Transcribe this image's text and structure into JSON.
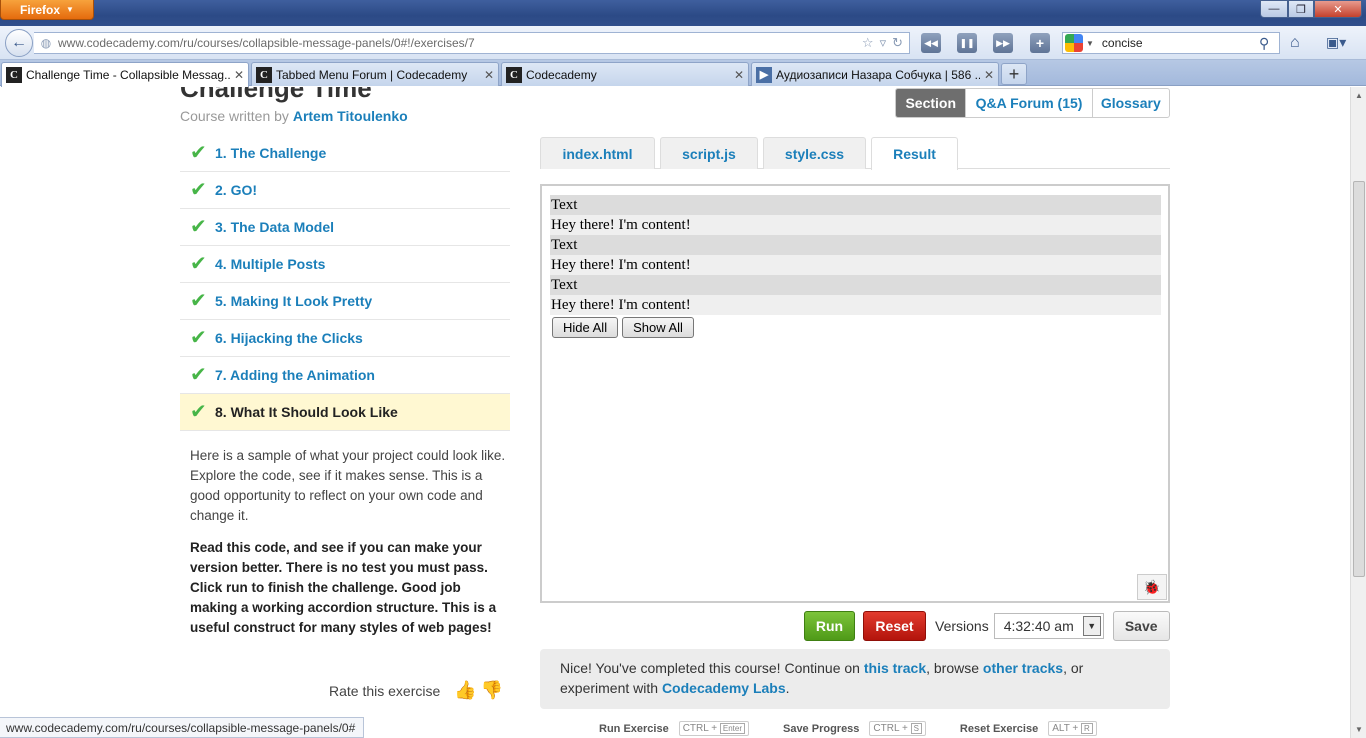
{
  "browser": {
    "menu_button": "Firefox",
    "url": "www.codecademy.com/ru/courses/collapsible-message-panels/0#!/exercises/7",
    "search_text": "concise",
    "window_controls": {
      "minimize": "—",
      "maximize": "❐",
      "close": "✕"
    },
    "tabs": [
      {
        "label": "Challenge Time - Collapsible Messag...",
        "close": "✕",
        "favicon": "C"
      },
      {
        "label": "Tabbed Menu Forum | Codecademy",
        "close": "✕",
        "favicon": "C"
      },
      {
        "label": "Codecademy",
        "close": "✕",
        "favicon": "C"
      },
      {
        "label": "Аудиозаписи Назара Собчука | 586 ...",
        "close": "✕",
        "favicon": "▶"
      }
    ],
    "new_tab": "+",
    "status_url": "www.codecademy.com/ru/courses/collapsible-message-panels/0#"
  },
  "course": {
    "title": "Challenge Time",
    "byline_prefix": "Course written by ",
    "author": "Artem Titoulenko"
  },
  "section_tabs": {
    "section": "Section",
    "forum": "Q&A Forum (15)",
    "glossary": "Glossary"
  },
  "lessons": [
    {
      "label": "1. The Challenge"
    },
    {
      "label": "2. GO!"
    },
    {
      "label": "3. The Data Model"
    },
    {
      "label": "4. Multiple Posts"
    },
    {
      "label": "5. Making It Look Pretty"
    },
    {
      "label": "6. Hijacking the Clicks"
    },
    {
      "label": "7. Adding the Animation"
    },
    {
      "label": "8. What It Should Look Like"
    }
  ],
  "instructions": {
    "text": "Here is a sample of what your project could look like. Explore the code, see if it makes sense. This is a good opportunity to reflect on your own code and change it.",
    "bold": "Read this code, and see if you can make your version better. There is no test you must pass. Click run to finish the challenge. Good job making a working accordion structure. This is a useful construct for many styles of web pages!"
  },
  "rate": {
    "label": "Rate this exercise",
    "up_icon": "👍",
    "down_icon": "👎"
  },
  "file_tabs": {
    "index": "index.html",
    "script": "script.js",
    "style": "style.css",
    "result": "Result"
  },
  "result": {
    "panels": [
      {
        "head": "Text",
        "body": "Hey there! I'm content!"
      },
      {
        "head": "Text",
        "body": "Hey there! I'm content!"
      },
      {
        "head": "Text",
        "body": "Hey there! I'm content!"
      }
    ],
    "hide_all": "Hide All",
    "show_all": "Show All"
  },
  "controls": {
    "run": "Run",
    "reset": "Reset",
    "versions_label": "Versions",
    "version_value": "4:32:40 am",
    "save": "Save"
  },
  "completion": {
    "part1": "Nice! You've completed this course! Continue on ",
    "link1": "this track",
    "part2": ", browse ",
    "link2": "other tracks",
    "part3": ", or experiment with ",
    "link3": "Codecademy Labs",
    "part4": "."
  },
  "shortcuts": [
    {
      "label": "Run Exercise",
      "mod": "CTRL +",
      "key": "Enter"
    },
    {
      "label": "Save Progress",
      "mod": "CTRL +",
      "key": "S"
    },
    {
      "label": "Reset Exercise",
      "mod": "ALT +",
      "key": "R"
    }
  ],
  "colors": {
    "link": "#1b7fba",
    "check": "#47b548",
    "run": "#5ea624",
    "reset": "#c41a10",
    "current_lesson_bg": "#fff8d2"
  }
}
